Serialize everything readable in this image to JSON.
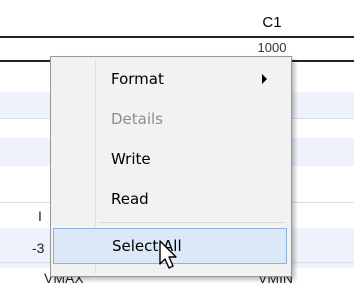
{
  "grid": {
    "column_header": "C1",
    "first_value": "1000",
    "left_clipped_chars": [
      "I",
      "-3"
    ],
    "footer_left": "VMAX",
    "footer_right": "VMIN"
  },
  "context_menu": {
    "items": [
      {
        "label": "Format",
        "has_submenu": true,
        "enabled": true
      },
      {
        "label": "Details",
        "has_submenu": false,
        "enabled": false
      },
      {
        "label": "Write",
        "has_submenu": false,
        "enabled": true
      },
      {
        "label": "Read",
        "has_submenu": false,
        "enabled": true
      },
      {
        "label": "Select All",
        "has_submenu": false,
        "enabled": true,
        "hovered": true
      }
    ]
  },
  "colors": {
    "menu_background": "#f2f2f2",
    "menu_hover": "#dbe8f7",
    "row_band": "#eef3fb"
  },
  "icons": {
    "pointer": "arrow-cursor-icon",
    "submenu": "chevron-right-icon"
  }
}
